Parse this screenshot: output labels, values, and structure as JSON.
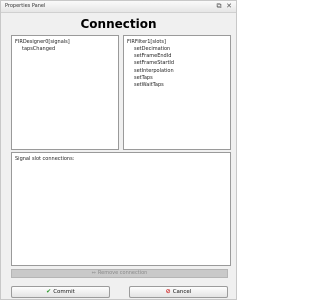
{
  "window": {
    "title": "Properties Panel",
    "restore_glyph": "⧉",
    "close_glyph": "✕",
    "restore_icon": "restore-icon",
    "close_icon": "close-icon"
  },
  "heading": "Connection",
  "signals_panel": {
    "title": "FIRDesigner0[signals]",
    "items": [
      "tapsChanged"
    ]
  },
  "slots_panel": {
    "title": "FIRFilter1[slots]",
    "items": [
      "setDecimation",
      "setFrameEndId",
      "setFrameStartId",
      "setInterpolation",
      "setTaps",
      "setWaitTaps"
    ]
  },
  "connections_panel": {
    "title": "Signal slot connections:"
  },
  "remove_button": {
    "label": "Remove connection",
    "icon": "remove-link-icon",
    "glyph": "⇔",
    "enabled": false
  },
  "commit_button": {
    "label": "Commit",
    "icon": "checkmark-icon",
    "glyph": "✔",
    "icon_color": "#2e9a2e"
  },
  "cancel_button": {
    "label": "Cancel",
    "icon": "cancel-icon",
    "glyph": "⊘",
    "icon_color": "#cc2222"
  }
}
